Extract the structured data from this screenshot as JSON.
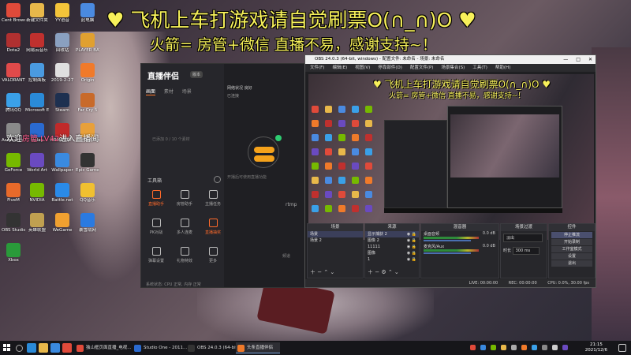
{
  "overlay": {
    "title": "♥ 飞机上车打游戏请自觉刷票O(∩_∩)O ♥",
    "subtitle": "火箭= 房管+微信 直播不易，感谢支持~！",
    "notice_prefix": "欢迎",
    "notice_highlight": "房管 LV42",
    "notice_suffix": "进入直播间"
  },
  "desktop_icons": [
    {
      "label": "Cent Browser",
      "color": "#e04a3a"
    },
    {
      "label": "新建文件夹",
      "color": "#e8b84a"
    },
    {
      "label": "YY语音",
      "color": "#f3c43a"
    },
    {
      "label": "此电脑",
      "color": "#4a8ae0"
    },
    {
      "label": "Dota2",
      "color": "#b03030"
    },
    {
      "label": "网易云音乐",
      "color": "#c0302e"
    },
    {
      "label": "回收站",
      "color": "#8aa0c0"
    },
    {
      "label": "PLAYER BATTLEG",
      "color": "#e0a030"
    },
    {
      "label": "VALORANT",
      "color": "#e04a4a"
    },
    {
      "label": "控制面板",
      "color": "#4a9ae0"
    },
    {
      "label": "2019-2-27",
      "color": "#e0e0e0"
    },
    {
      "label": "Origin",
      "color": "#f07a2a"
    },
    {
      "label": "腾讯QQ",
      "color": "#3aa0e8"
    },
    {
      "label": "Microsoft Edge",
      "color": "#2a8ad8"
    },
    {
      "label": "Steam",
      "color": "#1e3050"
    },
    {
      "label": "Far Cry 5",
      "color": "#c86a2a"
    },
    {
      "label": "Assassin's Creed",
      "color": "#8a8a8a"
    },
    {
      "label": "Uplay",
      "color": "#2a6ad0"
    },
    {
      "label": "ARMOURY CRATE",
      "color": "#c02a2a"
    },
    {
      "label": "腾讯WeGame",
      "color": "#e8a03a"
    },
    {
      "label": "GeForce",
      "color": "#76b900"
    },
    {
      "label": "World Art",
      "color": "#6a4ac0"
    },
    {
      "label": "Wallpaper",
      "color": "#3a8ae0"
    },
    {
      "label": "Epic Games",
      "color": "#333333"
    },
    {
      "label": "FiveM",
      "color": "#e86a2a"
    },
    {
      "label": "NVIDIA",
      "color": "#76b900"
    },
    {
      "label": "Battle.net",
      "color": "#2a8ae8"
    },
    {
      "label": "QQ音乐",
      "color": "#f0c030"
    },
    {
      "label": "OBS Studio",
      "color": "#333333"
    },
    {
      "label": "英雄联盟",
      "color": "#c0a050"
    },
    {
      "label": "WeGame",
      "color": "#f0a030"
    },
    {
      "label": "暴雪战网",
      "color": "#2a7ae0"
    },
    {
      "label": "Xbox",
      "color": "#2a9a3a"
    }
  ],
  "stream_app": {
    "logo": "直播伴侣",
    "version": "版本",
    "tabs": [
      "画面",
      "素材",
      "场景"
    ],
    "empty_hint": "已添加 0 / 10 个素材",
    "tools_label": "工具箱",
    "tools": [
      {
        "label": "直播助手",
        "orange": true
      },
      {
        "label": "房管助手",
        "orange": false
      },
      {
        "label": "主播任务",
        "orange": false
      },
      {
        "label": "PK对战",
        "orange": false
      },
      {
        "label": "多人连麦",
        "orange": false
      },
      {
        "label": "直播抽奖",
        "orange": true
      },
      {
        "label": "弹幕设置",
        "orange": false
      },
      {
        "label": "礼物特效",
        "orange": false
      },
      {
        "label": "更多",
        "orange": false
      }
    ],
    "status": "系统状态: CPU 正常, 内存 正常",
    "main_top": "网络状况 良好",
    "main_top2": "已连接",
    "main_hint": "开播后可使用直播功能",
    "rtmp": "rtmp",
    "channel": "频道"
  },
  "obs": {
    "title": "OBS 24.0.3 (64-bit, windows) - 配置文件: 未命名 - 场景: 未命名",
    "menu": [
      "文件(F)",
      "编辑(E)",
      "视图(V)",
      "停靠部件(D)",
      "配置文件(P)",
      "场景集合(S)",
      "工具(T)",
      "帮助(H)"
    ],
    "docks": {
      "scenes": {
        "title": "场景",
        "items": [
          "场景",
          "场景 2"
        ]
      },
      "sources": {
        "title": "来源",
        "items": [
          "显示捕获 2",
          "图像 2",
          "11111",
          "图像",
          "1"
        ]
      },
      "mixer": {
        "title": "混音器",
        "items": [
          {
            "name": "桌面音频",
            "db": "0.0 dB"
          },
          {
            "name": "麦克风/Aux",
            "db": "0.0 dB"
          }
        ]
      },
      "transitions": {
        "title": "场景过渡",
        "type": "淡出",
        "duration_label": "时长",
        "duration": "300 ms"
      },
      "controls": {
        "title": "控件",
        "buttons": [
          "停止推流",
          "开始录制",
          "工作室模式",
          "设置",
          "退出"
        ]
      }
    },
    "status": {
      "live": "LIVE: 00:00:00",
      "rec": "REC: 00:00:00",
      "cpu": "CPU: 0.0%, 30.00 fps"
    }
  },
  "taskbar": {
    "apps": [
      {
        "label": "独山框页面直播_电视...",
        "color": "#e04a3a"
      },
      {
        "label": "Studio One - 2011...",
        "color": "#2a6ad0"
      },
      {
        "label": "OBS 24.0.3 (64-bit...",
        "color": "#333333"
      },
      {
        "label": "头条直播伴侣",
        "color": "#f07a2a"
      }
    ],
    "time": "21:15",
    "date": "2021/12/6"
  }
}
